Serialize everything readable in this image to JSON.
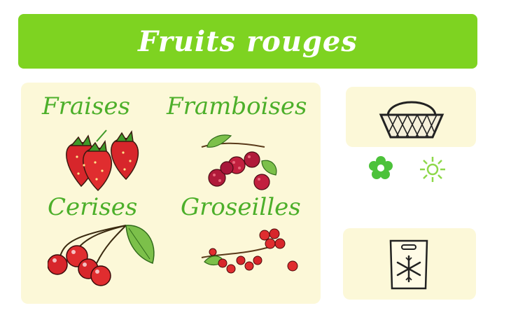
{
  "title": "Fruits rouges",
  "fruits": [
    {
      "label": "Fraises",
      "icon": "strawberry-icon"
    },
    {
      "label": "Framboises",
      "icon": "raspberry-icon"
    },
    {
      "label": "Cerises",
      "icon": "cherry-icon"
    },
    {
      "label": "Groseilles",
      "icon": "redcurrant-icon"
    }
  ],
  "icons": [
    "basket-icon",
    "flower-icon",
    "sun-icon",
    "freezer-bag-icon"
  ],
  "colors": {
    "banner": "#7ed321",
    "label": "#4caf2a",
    "panel": "#fcf8d8",
    "fruit_red": "#d7262b"
  }
}
